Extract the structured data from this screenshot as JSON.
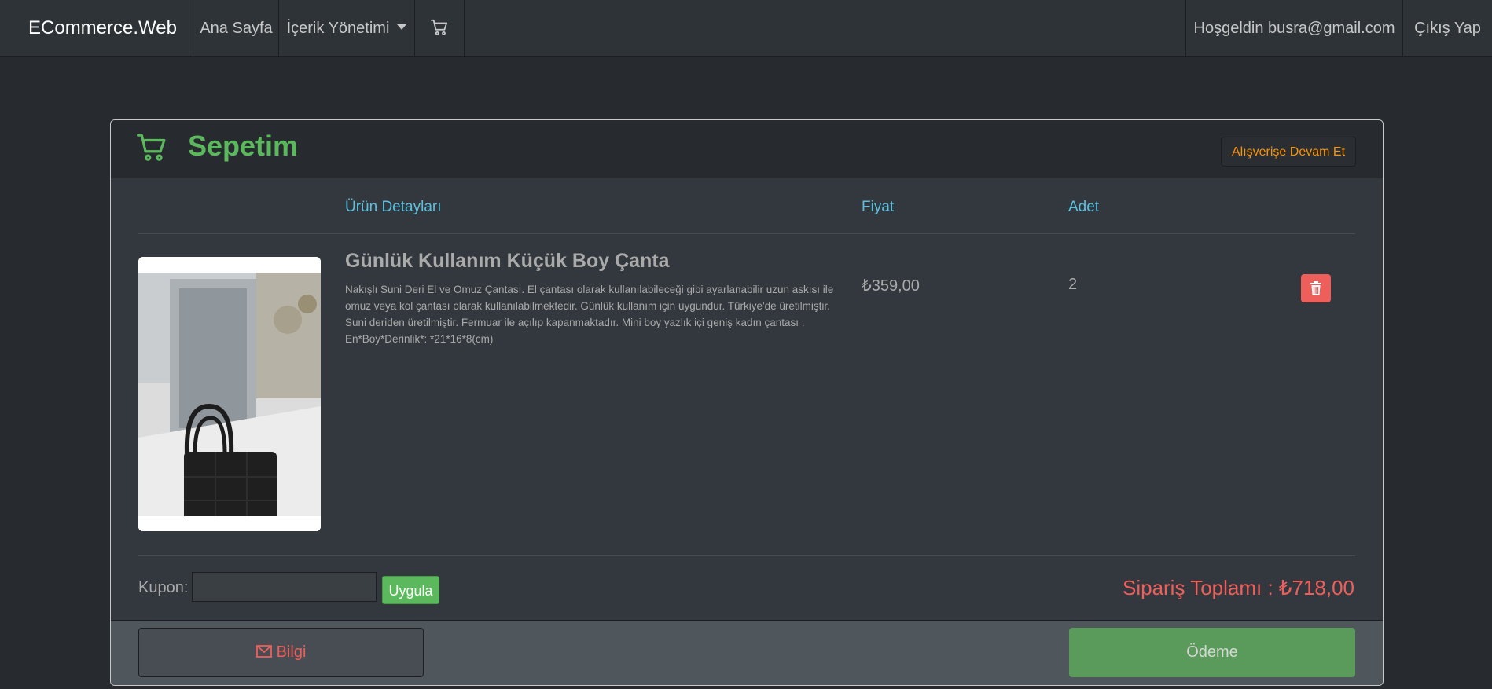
{
  "navbar": {
    "brand": "ECommerce.Web",
    "home": "Ana Sayfa",
    "content_management": "İçerik Yönetimi",
    "cart_icon": "cart-icon",
    "welcome": "Hoşgeldin busra@gmail.com",
    "logout": "Çıkış Yap"
  },
  "cart": {
    "title": "Sepetim",
    "continue_shopping": "Alışverişe Devam Et",
    "columns": {
      "detail": "Ürün Detayları",
      "price": "Fiyat",
      "quantity": "Adet"
    },
    "items": [
      {
        "name": "Günlük Kullanım Küçük Boy Çanta",
        "description": "Nakışlı Suni Deri El ve Omuz Çantası. El çantası olarak kullanılabileceği gibi ayarlanabilir uzun askısı ile omuz veya kol çantası olarak kullanılabilmektedir. Günlük kullanım için uygundur. Türkiye'de üretilmiştir. Suni deriden üretilmiştir. Fermuar ile açılıp kapanmaktadır. Mini boy yazlık içi geniş kadın çantası . En*Boy*Derinlik*: *21*16*8(cm)",
        "price": "₺359,00",
        "quantity": "2",
        "delete_icon": "trash-icon"
      }
    ],
    "coupon_label": "Kupon:",
    "coupon_value": "",
    "apply_label": "Uygula",
    "order_total": "Sipariş Toplamı : ₺718,00",
    "info_label": "Bilgi",
    "pay_label": "Ödeme"
  },
  "colors": {
    "background": "#272b30",
    "title_green": "#5cb85c",
    "header_blue": "#5bc0de",
    "danger_red": "#ee5f5b",
    "warning_orange": "#f89406"
  }
}
